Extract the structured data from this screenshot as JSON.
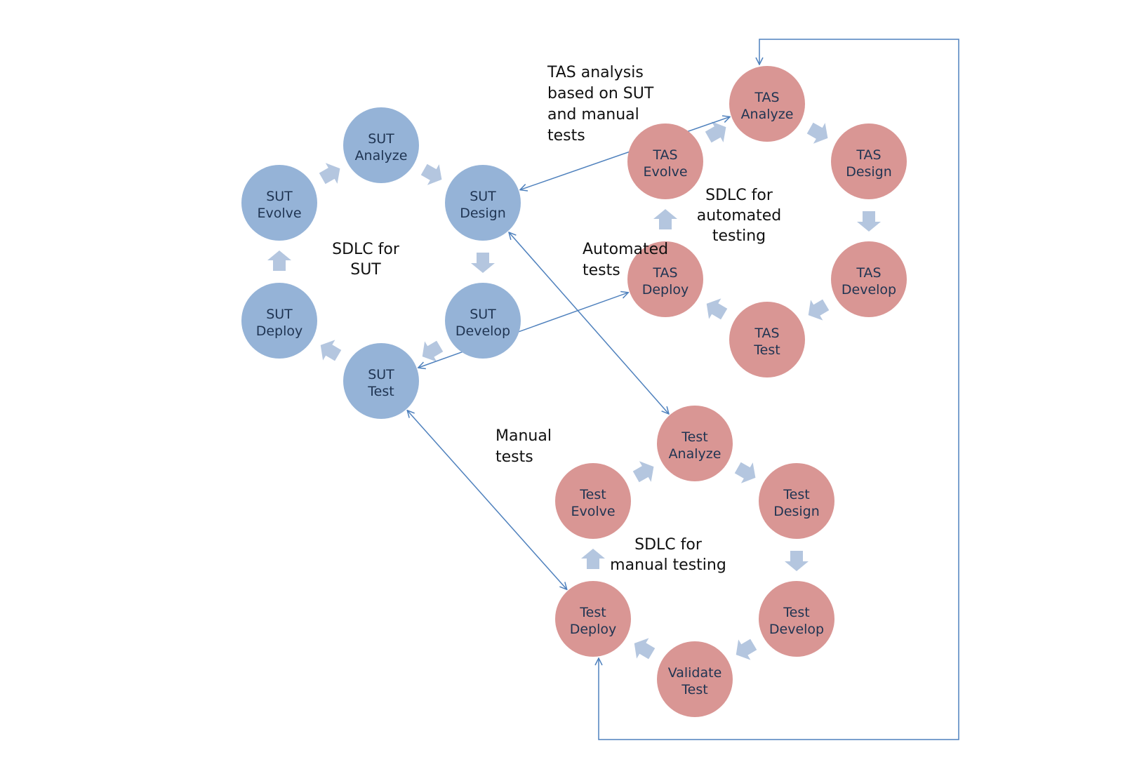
{
  "colors": {
    "sut_node": "#95b3d7",
    "tas_node": "#d99694",
    "node_text": "#1f3452",
    "flow_arrow": "#b4c6df",
    "connector": "#4f81bd",
    "text": "#111111"
  },
  "cycles": [
    {
      "id": "sut",
      "title_lines": [
        "SDLC for",
        "SUT"
      ],
      "nodes": [
        {
          "id": "sut-analyze",
          "lines": [
            "SUT",
            "Analyze"
          ]
        },
        {
          "id": "sut-design",
          "lines": [
            "SUT",
            "Design"
          ]
        },
        {
          "id": "sut-develop",
          "lines": [
            "SUT",
            "Develop"
          ]
        },
        {
          "id": "sut-test",
          "lines": [
            "SUT",
            "Test"
          ]
        },
        {
          "id": "sut-deploy",
          "lines": [
            "SUT",
            "Deploy"
          ]
        },
        {
          "id": "sut-evolve",
          "lines": [
            "SUT",
            "Evolve"
          ]
        }
      ]
    },
    {
      "id": "tas",
      "title_lines": [
        "SDLC for",
        "automated",
        "testing"
      ],
      "nodes": [
        {
          "id": "tas-analyze",
          "lines": [
            "TAS",
            "Analyze"
          ]
        },
        {
          "id": "tas-design",
          "lines": [
            "TAS",
            "Design"
          ]
        },
        {
          "id": "tas-develop",
          "lines": [
            "TAS",
            "Develop"
          ]
        },
        {
          "id": "tas-test",
          "lines": [
            "TAS",
            "Test"
          ]
        },
        {
          "id": "tas-deploy",
          "lines": [
            "TAS",
            "Deploy"
          ]
        },
        {
          "id": "tas-evolve",
          "lines": [
            "TAS",
            "Evolve"
          ]
        }
      ]
    },
    {
      "id": "manual",
      "title_lines": [
        "SDLC for",
        "manual testing"
      ],
      "nodes": [
        {
          "id": "test-analyze",
          "lines": [
            "Test",
            "Analyze"
          ]
        },
        {
          "id": "test-design",
          "lines": [
            "Test",
            "Design"
          ]
        },
        {
          "id": "test-develop",
          "lines": [
            "Test",
            "Develop"
          ]
        },
        {
          "id": "validate-test",
          "lines": [
            "Validate",
            "Test"
          ]
        },
        {
          "id": "test-deploy",
          "lines": [
            "Test",
            "Deploy"
          ]
        },
        {
          "id": "test-evolve",
          "lines": [
            "Test",
            "Evolve"
          ]
        }
      ]
    }
  ],
  "connectors": [
    {
      "id": "tas-analysis-link",
      "from": "tas-analyze",
      "to": "sut-design",
      "bidirectional": true,
      "label_lines": [
        "TAS analysis",
        "based on SUT",
        "and manual",
        "tests"
      ]
    },
    {
      "id": "automated-tests-link",
      "from": "sut-test",
      "to": "tas-deploy",
      "bidirectional": true,
      "label_lines": [
        "Automated",
        "tests"
      ]
    },
    {
      "id": "manual-tests-link",
      "from": "sut-test",
      "to": "test-deploy",
      "bidirectional": true,
      "label_lines": [
        "Manual",
        "tests"
      ]
    },
    {
      "id": "design-to-test-analyze-link",
      "from": "sut-design",
      "to": "test-analyze",
      "bidirectional": true,
      "label_lines": []
    },
    {
      "id": "feedback-loop",
      "from": "test-deploy",
      "to": "tas-analyze",
      "bidirectional": true,
      "label_lines": []
    }
  ]
}
